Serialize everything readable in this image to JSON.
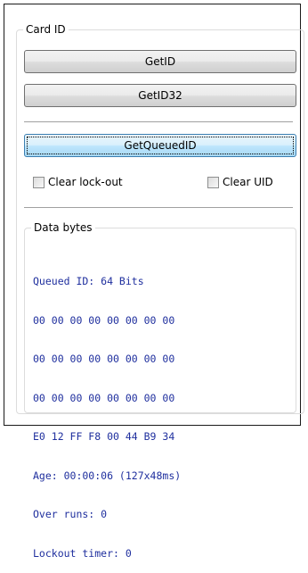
{
  "card_id": {
    "title": "Card ID",
    "buttons": {
      "get_id": "GetID",
      "get_id32": "GetID32",
      "get_queued_id": "GetQueuedID"
    },
    "checkboxes": {
      "clear_lockout": {
        "label": "Clear lock-out",
        "checked": false
      },
      "clear_uid": {
        "label": "Clear UID",
        "checked": false
      }
    },
    "data_bytes": {
      "title": "Data bytes",
      "lines": [
        "Queued ID: 64 Bits",
        "00 00 00 00 00 00 00 00",
        "00 00 00 00 00 00 00 00",
        "00 00 00 00 00 00 00 00",
        "E0 12 FF F8 00 44 B9 34",
        "Age: 00:00:06 (127x48ms)",
        "Over runs: 0",
        "Lockout timer: 0"
      ]
    }
  },
  "colors": {
    "data_text": "#1f2f9e",
    "focus_border": "#3c7fb1"
  }
}
